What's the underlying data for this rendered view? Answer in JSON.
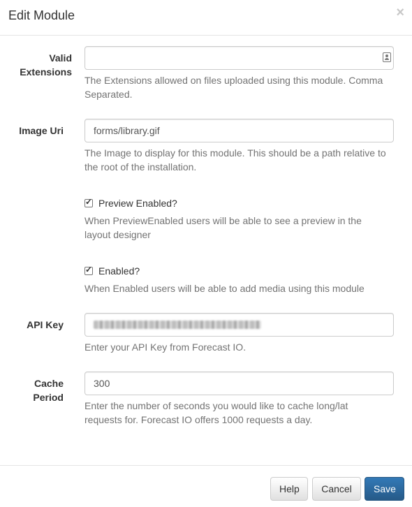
{
  "modal": {
    "title": "Edit Module",
    "close_label": "×"
  },
  "fields": {
    "valid_extensions": {
      "label_line1": "Valid",
      "label_line2": "Extensions",
      "value": "",
      "help_line1": "The Extensions allowed on files uploaded using this module. Comma",
      "help_line2": "Separated."
    },
    "image_uri": {
      "label": "Image Uri",
      "value": "forms/library.gif",
      "help_line1": "The Image to display for this module. This should be a path relative to",
      "help_line2": "the root of the installation."
    },
    "preview_enabled": {
      "label": "Preview Enabled?",
      "checked": true,
      "help_line1": "When PreviewEnabled users will be able to see a preview in the",
      "help_line2": "layout designer"
    },
    "enabled": {
      "label": "Enabled?",
      "checked": true,
      "help": "When Enabled users will be able to add media using this module"
    },
    "api_key": {
      "label": "API Key",
      "help": "Enter your API Key from Forecast IO."
    },
    "cache_period": {
      "label_line1": "Cache",
      "label_line2": "Period",
      "value": "300",
      "help_line1": "Enter the number of seconds you would like to cache long/lat",
      "help_line2": "requests for. Forecast IO offers 1000 requests a day."
    }
  },
  "footer": {
    "help_label": "Help",
    "cancel_label": "Cancel",
    "save_label": "Save"
  },
  "colors": {
    "primary": "#337ab7",
    "help_text": "#737373"
  },
  "icons": {
    "contact": "contact-card-icon",
    "close": "close-icon",
    "check": "checkmark-icon"
  }
}
